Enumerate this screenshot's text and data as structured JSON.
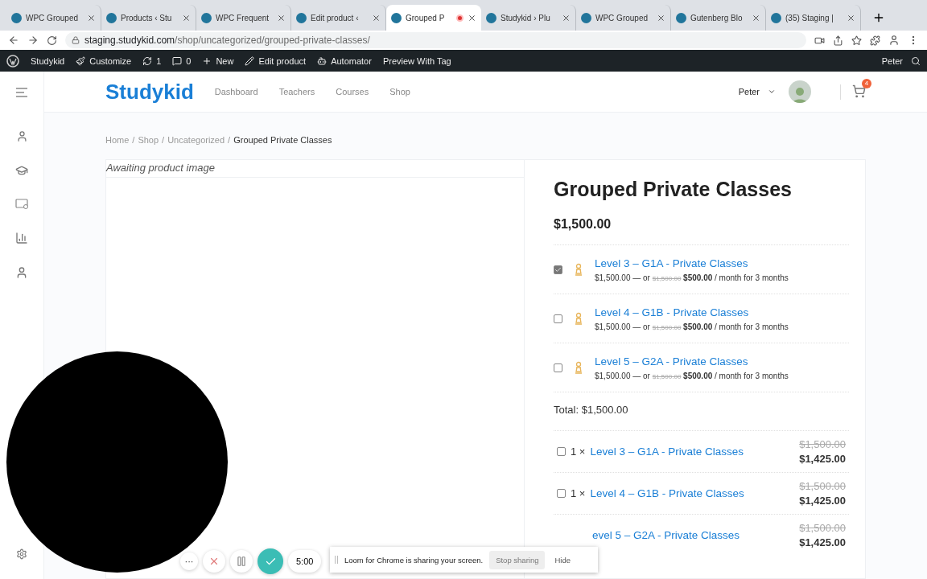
{
  "browser": {
    "tabs": [
      {
        "title": "WPC Grouped",
        "selected": false,
        "recording": false
      },
      {
        "title": "Products ‹ Stu",
        "selected": false,
        "recording": false
      },
      {
        "title": "WPC Frequent",
        "selected": false,
        "recording": false
      },
      {
        "title": "Edit product ‹",
        "selected": false,
        "recording": false
      },
      {
        "title": "Grouped P",
        "selected": true,
        "recording": true
      },
      {
        "title": "Studykid › Plu",
        "selected": false,
        "recording": false
      },
      {
        "title": "WPC Grouped",
        "selected": false,
        "recording": false
      },
      {
        "title": "Gutenberg Blo",
        "selected": false,
        "recording": false
      },
      {
        "title": "(35) Staging |",
        "selected": false,
        "recording": false
      }
    ],
    "url_host": "staging.studykid.com",
    "url_path": "/shop/uncategorized/grouped-private-classes/"
  },
  "admin_bar": {
    "items": [
      "Studykid",
      "Customize",
      "1",
      "0",
      "New",
      "Edit product",
      "Automator",
      "Preview With Tag"
    ],
    "user": "Peter"
  },
  "header": {
    "logo": "Studykid",
    "nav": [
      "Dashboard",
      "Teachers",
      "Courses",
      "Shop"
    ],
    "user": "Peter",
    "cart_count": "4"
  },
  "breadcrumb": {
    "links": [
      "Home",
      "Shop",
      "Uncategorized"
    ],
    "separator": "/",
    "current": "Grouped Private Classes"
  },
  "product": {
    "image_alt": "Awaiting product image",
    "title": "Grouped Private Classes",
    "price": "$1,500.00",
    "items": [
      {
        "name": "Level 3 – G1A - Private Classes",
        "price": "$1,500.00",
        "or": "— or",
        "old": "$1,500.00",
        "installment": "$500.00",
        "terms": "/ month for 3 months",
        "checked": true
      },
      {
        "name": "Level 4 – G1B - Private Classes",
        "price": "$1,500.00",
        "or": "— or",
        "old": "$1,500.00",
        "installment": "$500.00",
        "terms": "/ month for 3 months",
        "checked": false
      },
      {
        "name": "Level 5 – G2A - Private Classes",
        "price": "$1,500.00",
        "or": "— or",
        "old": "$1,500.00",
        "installment": "$500.00",
        "terms": "/ month for 3 months",
        "checked": false
      }
    ],
    "total": "Total: $1,500.00",
    "bundle": [
      {
        "quantity": "1 ×",
        "name": "Level 3 – G1A - Private Classes",
        "old": "$1,500.00",
        "price": "$1,425.00",
        "checked": false
      },
      {
        "quantity": "1 ×",
        "name": "Level 4 – G1B - Private Classes",
        "old": "$1,500.00",
        "price": "$1,425.00",
        "checked": false
      },
      {
        "name": "evel 5 – G2A - Private Classes",
        "old": "$1,500.00",
        "price": "$1,425.00"
      }
    ]
  },
  "loom": {
    "controls": [
      "···",
      "5:00"
    ],
    "message": "Loom for Chrome is sharing your screen.",
    "stop": "Stop sharing",
    "hide": "Hide"
  }
}
